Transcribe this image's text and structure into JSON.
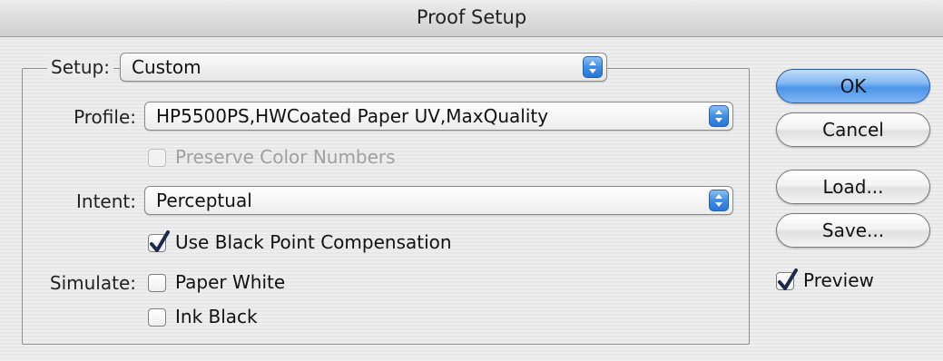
{
  "window": {
    "title": "Proof Setup"
  },
  "setup": {
    "label": "Setup:",
    "value": "Custom"
  },
  "profile": {
    "label": "Profile:",
    "value": "HP5500PS,HWCoated Paper UV,MaxQuality"
  },
  "preserve_color_numbers": {
    "label": "Preserve Color Numbers",
    "checked": false,
    "enabled": false
  },
  "intent": {
    "label": "Intent:",
    "value": "Perceptual"
  },
  "black_point": {
    "label": "Use Black Point Compensation",
    "checked": true
  },
  "simulate": {
    "label": "Simulate:",
    "paper_white": {
      "label": "Paper White",
      "checked": false
    },
    "ink_black": {
      "label": "Ink Black",
      "checked": false
    }
  },
  "buttons": {
    "ok": "OK",
    "cancel": "Cancel",
    "load": "Load...",
    "save": "Save..."
  },
  "preview": {
    "label": "Preview",
    "checked": true
  },
  "colors": {
    "accent_blue": "#3f8ee6",
    "check_mark": "#1a2a4a"
  }
}
